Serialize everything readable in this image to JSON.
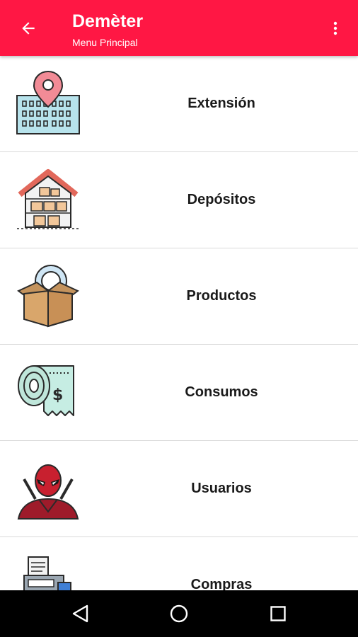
{
  "appbar": {
    "title": "Demèter",
    "subtitle": "Menu Principal",
    "back_icon": "arrow-back-icon",
    "more_icon": "more-vert-icon",
    "color": "#ff1744"
  },
  "menu": {
    "items": [
      {
        "label": "Extensión",
        "icon": "map-location-icon"
      },
      {
        "label": "Depósitos",
        "icon": "warehouse-icon"
      },
      {
        "label": "Productos",
        "icon": "box-gear-icon"
      },
      {
        "label": "Consumos",
        "icon": "receipt-roll-icon"
      },
      {
        "label": "Usuarios",
        "icon": "user-avatar-icon"
      },
      {
        "label": "Compras",
        "icon": "cash-register-icon"
      }
    ]
  },
  "navbar": {
    "back": "nav-back-icon",
    "home": "nav-home-icon",
    "recents": "nav-recents-icon"
  }
}
